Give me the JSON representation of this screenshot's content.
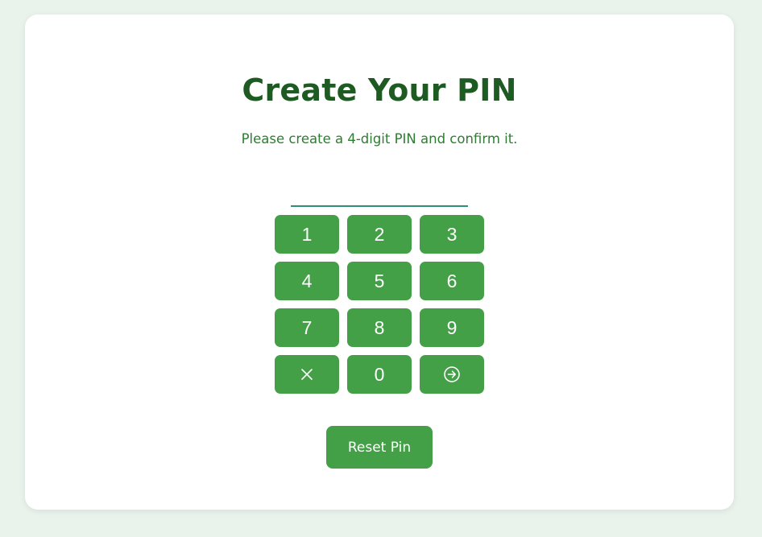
{
  "page": {
    "title": "Create Your PIN",
    "subtitle": "Please create a 4-digit PIN and confirm it."
  },
  "pin_input": {
    "value": ""
  },
  "keypad": {
    "keys": [
      "1",
      "2",
      "3",
      "4",
      "5",
      "6",
      "7",
      "8",
      "9"
    ],
    "zero": "0",
    "clear_icon": "close-icon",
    "submit_icon": "arrow-right-circle-icon"
  },
  "reset_button": {
    "label": "Reset Pin"
  },
  "colors": {
    "background": "#e9f3ec",
    "card": "#ffffff",
    "title": "#1d5b22",
    "subtitle": "#2e7d32",
    "button": "#43a047",
    "button_text": "#ffffff",
    "input_underline": "#2f8f74"
  }
}
